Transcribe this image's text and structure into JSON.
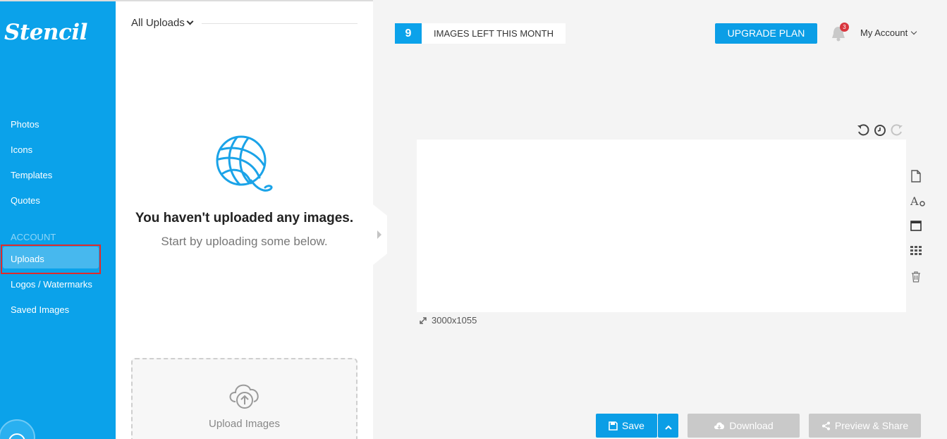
{
  "brand": {
    "logo_text": "Stencil"
  },
  "sidebar": {
    "items": [
      {
        "label": "Photos"
      },
      {
        "label": "Icons"
      },
      {
        "label": "Templates"
      },
      {
        "label": "Quotes"
      }
    ],
    "section_label": "ACCOUNT",
    "account_items": [
      {
        "label": "Uploads",
        "active": true
      },
      {
        "label": "Logos / Watermarks"
      },
      {
        "label": "Saved Images"
      }
    ]
  },
  "panel": {
    "title": "All Uploads",
    "empty_title": "You haven't uploaded any images.",
    "empty_subtitle": "Start by uploading some below.",
    "upload_label": "Upload Images"
  },
  "topbar": {
    "images_left_count": "9",
    "images_left_text": "IMAGES LEFT THIS MONTH",
    "upgrade_label": "UPGRADE PLAN",
    "notification_count": "3",
    "account_label": "My Account"
  },
  "canvas": {
    "dimensions": "3000x1055"
  },
  "actions": {
    "save_label": "Save",
    "download_label": "Download",
    "preview_label": "Preview & Share"
  },
  "colors": {
    "brand_blue": "#0ba2ea",
    "button_blue": "#0b9ee6",
    "disabled_gray": "#c9c9c9",
    "badge_red": "#d9363e",
    "highlight_red": "#e02b2b"
  }
}
